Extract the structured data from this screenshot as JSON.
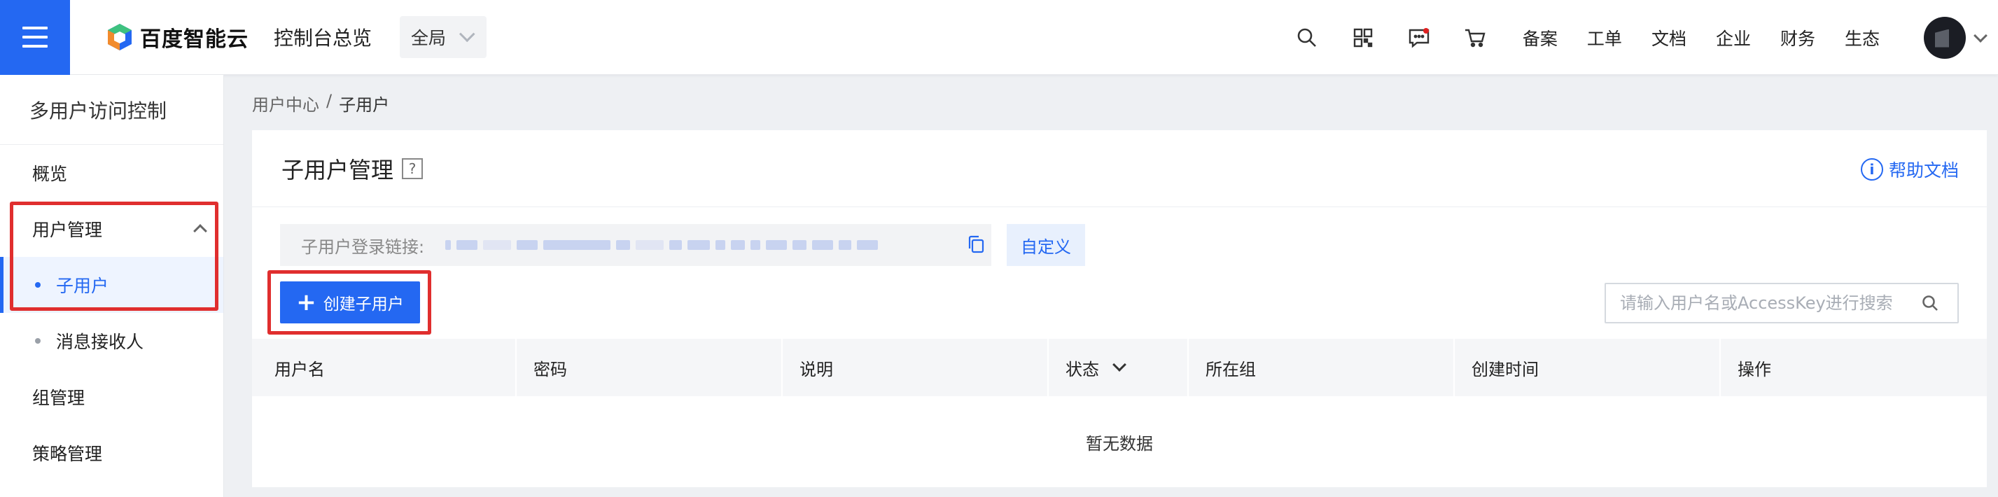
{
  "header": {
    "brand": "百度智能云",
    "console_title": "控制台总览",
    "region": "全局",
    "links": [
      "备案",
      "工单",
      "文档",
      "企业",
      "财务",
      "生态"
    ],
    "icons": [
      "search-icon",
      "qrcode-icon",
      "message-icon",
      "cart-icon"
    ]
  },
  "sidebar": {
    "title": "多用户访问控制",
    "items": [
      {
        "label": "概览"
      },
      {
        "label": "用户管理"
      },
      {
        "label": "子用户"
      },
      {
        "label": "消息接收人"
      },
      {
        "label": "组管理"
      },
      {
        "label": "策略管理"
      }
    ]
  },
  "breadcrumb": {
    "parent": "用户中心",
    "separator": "/",
    "current": "子用户"
  },
  "main": {
    "title": "子用户管理",
    "help_mark": "?",
    "help_doc": "帮助文档",
    "login_link_label": "子用户登录链接:",
    "customize": "自定义",
    "create_button": "创建子用户",
    "search_placeholder": "请输入用户名或AccessKey进行搜索",
    "table": {
      "columns": [
        "用户名",
        "密码",
        "说明",
        "状态",
        "所在组",
        "创建时间",
        "操作"
      ],
      "empty_text": "暂无数据"
    }
  },
  "colors": {
    "accent": "#2468f2",
    "highlight_box": "#e02e2e"
  }
}
